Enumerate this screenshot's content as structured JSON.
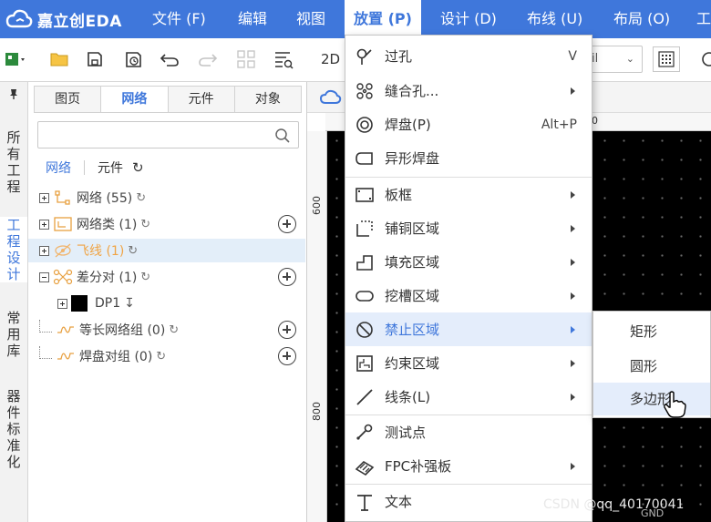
{
  "app": {
    "name": "嘉立创EDA"
  },
  "menubar": {
    "items": [
      {
        "label": "文件 (F)"
      },
      {
        "label": "编辑"
      },
      {
        "label": "视图"
      },
      {
        "label": "放置 (P)"
      },
      {
        "label": "设计 (D)"
      },
      {
        "label": "布线 (U)"
      },
      {
        "label": "布局 (O)"
      },
      {
        "label": "工"
      }
    ]
  },
  "toolbar": {
    "view_2d_label": "2D",
    "unit_value": "il"
  },
  "vertical_tabs": [
    {
      "label": "所有工程"
    },
    {
      "label": "工程设计"
    },
    {
      "label": "常用库"
    },
    {
      "label": "器件标准化"
    }
  ],
  "panel": {
    "tabs": [
      {
        "label": "图页"
      },
      {
        "label": "网络"
      },
      {
        "label": "元件"
      },
      {
        "label": "对象"
      }
    ],
    "search": {
      "value": "",
      "placeholder": ""
    },
    "subtabs": [
      {
        "label": "网络"
      },
      {
        "label": "元件"
      }
    ],
    "tree": [
      {
        "label": "网络 (55)"
      },
      {
        "label": "网络类 (1)"
      },
      {
        "label": "飞线 (1)"
      },
      {
        "label": "差分对 (1)"
      },
      {
        "label": "DP1"
      },
      {
        "label": "等长网络组 (0)"
      },
      {
        "label": "焊盘对组 (0)"
      }
    ]
  },
  "canvas": {
    "ruler_left": [
      "600",
      "800"
    ],
    "gnd_label": "GND"
  },
  "dropdown": {
    "items": [
      {
        "label": "过孔",
        "shortcut": "V"
      },
      {
        "label": "缝合孔..."
      },
      {
        "label": "焊盘(P)",
        "shortcut": "Alt+P"
      },
      {
        "label": "异形焊盘"
      },
      {
        "label": "板框"
      },
      {
        "label": "铺铜区域"
      },
      {
        "label": "填充区域"
      },
      {
        "label": "挖槽区域"
      },
      {
        "label": "禁止区域"
      },
      {
        "label": "约束区域"
      },
      {
        "label": "线条(L)"
      },
      {
        "label": "测试点"
      },
      {
        "label": "FPC补强板"
      },
      {
        "label": "文本"
      }
    ]
  },
  "submenu": {
    "items": [
      {
        "label": "矩形"
      },
      {
        "label": "圆形"
      },
      {
        "label": "多边形"
      }
    ]
  },
  "watermark": "CSDN @qq_40170041",
  "colors": {
    "accent": "#3f77db",
    "menu_highlight": "#e4edfb",
    "board": "#000000"
  }
}
